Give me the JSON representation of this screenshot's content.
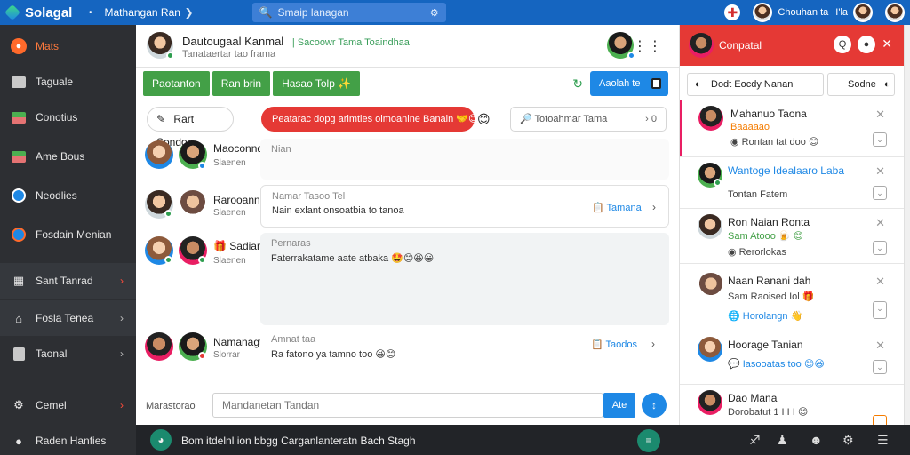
{
  "colors": {
    "topbar": "#1565c0",
    "sidebar": "#2d2f33",
    "accent_orange": "#ff6a2b",
    "tab_green": "#43a047",
    "alert_red": "#e53935",
    "primary_blue": "#1e88e5",
    "online_green": "#2e9e4f"
  },
  "topbar": {
    "app_name": "Solagal",
    "crumb_sep": "•",
    "crumb": "Mathangan Ran",
    "crumb_chev": "❯",
    "search_placeholder": "Smaip lanagan",
    "search_icon": "search-icon",
    "user_name": "Chouhan ta",
    "user_count": "I'la"
  },
  "sidebar": {
    "items": [
      {
        "label": "Mats",
        "icon": "chat-bubble-icon"
      },
      {
        "label": "Taguale",
        "icon": "folder-icon"
      },
      {
        "label": "Conotius",
        "icon": "image-icon"
      },
      {
        "label": "Ame Bous",
        "icon": "photo-icon"
      },
      {
        "label": "Neodlies",
        "icon": "clock-icon"
      },
      {
        "label": "Fosdain Menian",
        "icon": "globe-icon"
      },
      {
        "label": "Sant Tanrad",
        "icon": "grid-icon",
        "chev": "›"
      },
      {
        "label": "Fosla Tenea",
        "icon": "home-icon",
        "chev": "›"
      },
      {
        "label": "Taonal",
        "icon": "document-icon",
        "chev": "›"
      },
      {
        "label": "Cemel",
        "icon": "settings-icon",
        "chev": "›"
      },
      {
        "label": "Raden Hanfies",
        "icon": "user-icon"
      }
    ]
  },
  "chat": {
    "title": "Dautougaal Kanmal",
    "title_extra": "| Sacoowr Tama Toaindhaa",
    "subtitle": "Tanataertar tao frama",
    "menu_dots": "⋮⋮",
    "tabs": [
      "Paotanton",
      "Ran brin",
      "Hasao Tolp ✨"
    ],
    "refresh_icon": "↻",
    "action_label": "Aaolah te",
    "edit_icon": "✎",
    "edit_label": "Rart Sondon",
    "alert_text": "Peatarac dopg arimtles oimoanine Banain 🤝😊",
    "alert_emoji": "😊",
    "filter_label": "🔎  Totoahmar Tama",
    "filter_end": "›  0",
    "messages": [
      {
        "name": "Maoconnd",
        "time": "Slaenen",
        "bubble_head": "Nian",
        "bubble_text": ""
      },
      {
        "name": "Rarooann",
        "time": "Slaenen",
        "bubble_head": "Namar Tasoo Tel",
        "bubble_text": "Nain exlant onsoatbia to tanoa",
        "action": "📋 Tamana",
        "arrow": "›"
      },
      {
        "name": "🎁 Sadian",
        "time": "Slaenen",
        "bubble_head": "Pernaras",
        "bubble_text": "Faterrakatame aate atbaka 🤩😊😆😀"
      },
      {
        "name": "Namanagt",
        "time": "Slorrar",
        "bubble_head": "Amnat taa",
        "bubble_text": "Ra fatono ya tamno too 😆😊",
        "action": "📋 Taodos",
        "arrow": "›"
      }
    ],
    "composer_label": "Marastorao",
    "composer_placeholder": "Mandanetan Tandan",
    "send_label": "Ate",
    "fab_icon": "↕"
  },
  "rpanel": {
    "title": "Conpatal",
    "search_icon": "Q",
    "close_icon": "✕",
    "filter_icon": "◐",
    "filter_label": "Dodt Eocdy Nanan",
    "sort_label": "Sodne",
    "sort_icon": "◐",
    "contacts": [
      {
        "name": "Mahanuo Taona",
        "sub": "Baaaaao",
        "line3": "◉ Rontan tat doo 😊",
        "sub_color": "#f57c00"
      },
      {
        "name": "Wantoge Idealaaro Laba",
        "sub": "",
        "line3": "Tontan Fatem",
        "sub_color": "#1e88e5"
      },
      {
        "name": "Ron Naian Ronta",
        "sub": "Sam Atooo 🍺 😊",
        "line3": "◉ Rerorlokas",
        "sub_color": "#43a047"
      },
      {
        "name": "Naan Ranani dah",
        "sub": "Sam Raoised Iol 🎁",
        "line3": "🌐 Horolangn 👋",
        "sub_color": "#444444"
      },
      {
        "name": "Hoorage Tanian",
        "sub": "💬 Iasooatas too 😊😆",
        "line3": "",
        "sub_color": "#1e88e5"
      },
      {
        "name": "Dao Mana",
        "sub": "Dorobatut 1 I I I 😊",
        "line3": "",
        "sub_color": "#444444"
      }
    ]
  },
  "bottombar": {
    "bot_icon": "◕",
    "text": "Bom itdelnl ion bbgg Carganlanteratn Bach Stagh",
    "fab_icon": "≡",
    "icons": [
      "♐",
      "♟",
      "☻",
      "⚙",
      "☰"
    ]
  }
}
